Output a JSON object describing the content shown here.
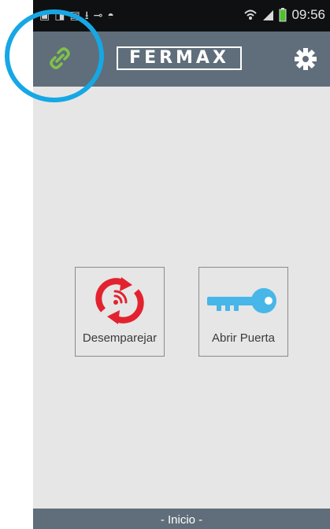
{
  "status_bar": {
    "time": "09:56",
    "left_icons": [
      "notification-icon-1",
      "notification-icon-2",
      "gallery-icon",
      "download-icon",
      "key-icon",
      "app-icon"
    ],
    "right_icons": [
      "wifi-icon",
      "signal-icon",
      "battery-icon"
    ]
  },
  "app_bar": {
    "logo_text": "FERMAX",
    "link_icon": "link-icon",
    "settings_icon": "gear-icon"
  },
  "actions": [
    {
      "label": "Desemparejar",
      "icon": "unpair-icon"
    },
    {
      "label": "Abrir Puerta",
      "icon": "key-icon"
    }
  ],
  "footer": {
    "label": "- Inicio -"
  },
  "colors": {
    "app_bar": "#5f6e7a",
    "background": "#e6e6e6",
    "link_green": "#7fc24a",
    "unpair_red": "#e2232f",
    "key_blue": "#47b6e8",
    "highlight": "#16a7e5"
  }
}
